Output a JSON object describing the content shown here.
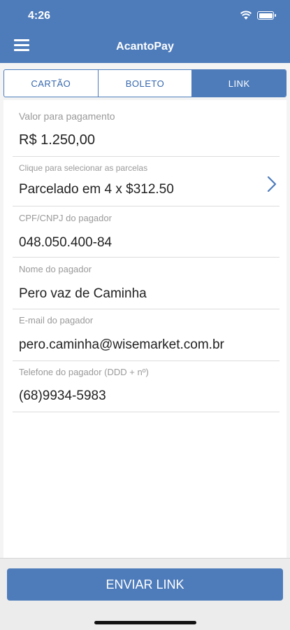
{
  "status_bar": {
    "time": "4:26"
  },
  "header": {
    "title": "AcantoPay"
  },
  "tabs": [
    {
      "label": "CARTÃO",
      "active": false
    },
    {
      "label": "BOLETO",
      "active": false
    },
    {
      "label": "LINK",
      "active": true
    }
  ],
  "form": {
    "amount": {
      "label": "Valor para pagamento",
      "value": "R$ 1.250,00"
    },
    "installments": {
      "label": "Clique para selecionar as parcelas",
      "value": "Parcelado em 4 x $312.50"
    },
    "document": {
      "label": "CPF/CNPJ do pagador",
      "value": "048.050.400-84"
    },
    "name": {
      "label": "Nome do pagador",
      "value": "Pero vaz de Caminha"
    },
    "email": {
      "label": "E-mail do pagador",
      "value": "pero.caminha@wisemarket.com.br"
    },
    "phone": {
      "label": "Telefone do pagador (DDD + nº)",
      "value": "(68)9934-5983"
    }
  },
  "actions": {
    "send_label": "ENVIAR LINK"
  },
  "colors": {
    "primary": "#4e7cbb",
    "tab_text": "#3567ad",
    "label": "#9a9a9a"
  },
  "icons": {
    "menu": "hamburger-menu-icon",
    "chevron": "chevron-right-icon",
    "wifi": "wifi-icon",
    "battery": "battery-icon"
  }
}
